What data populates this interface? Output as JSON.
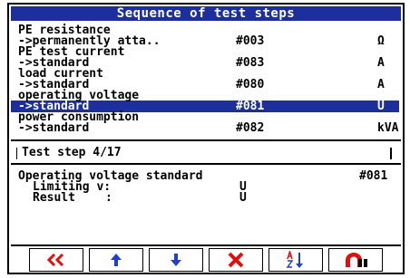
{
  "title": "Sequence of test steps",
  "steps": [
    {
      "name": "PE resistance",
      "mode": "->permanently atta..",
      "code": "#003",
      "unit": "Ω"
    },
    {
      "name": "PE test current",
      "mode": "->standard",
      "code": "#083",
      "unit": "A"
    },
    {
      "name": "load current",
      "mode": "->standard",
      "code": "#080",
      "unit": "A"
    },
    {
      "name": "operating voltage",
      "mode": "->standard",
      "code": "#081",
      "unit": "U"
    },
    {
      "name": "power consumption",
      "mode": "->standard",
      "code": "#082",
      "unit": "kVA"
    }
  ],
  "selected_step_index": 3,
  "status": {
    "text": "Test step 4/17"
  },
  "detail": {
    "heading": "Operating voltage standard",
    "code": "#081",
    "limit_label": "Limiting v:",
    "limit_unit": "U",
    "result_label": "Result",
    "result_sep": ":",
    "result_unit": "U"
  },
  "toolbar": {
    "buttons": [
      "rewind-icon",
      "arrow-up-icon",
      "arrow-down-icon",
      "delete-icon",
      "sort-az-icon",
      "magnet-icon"
    ],
    "colors": {
      "blue": "#1f3fd0",
      "red": "#e01010"
    }
  }
}
